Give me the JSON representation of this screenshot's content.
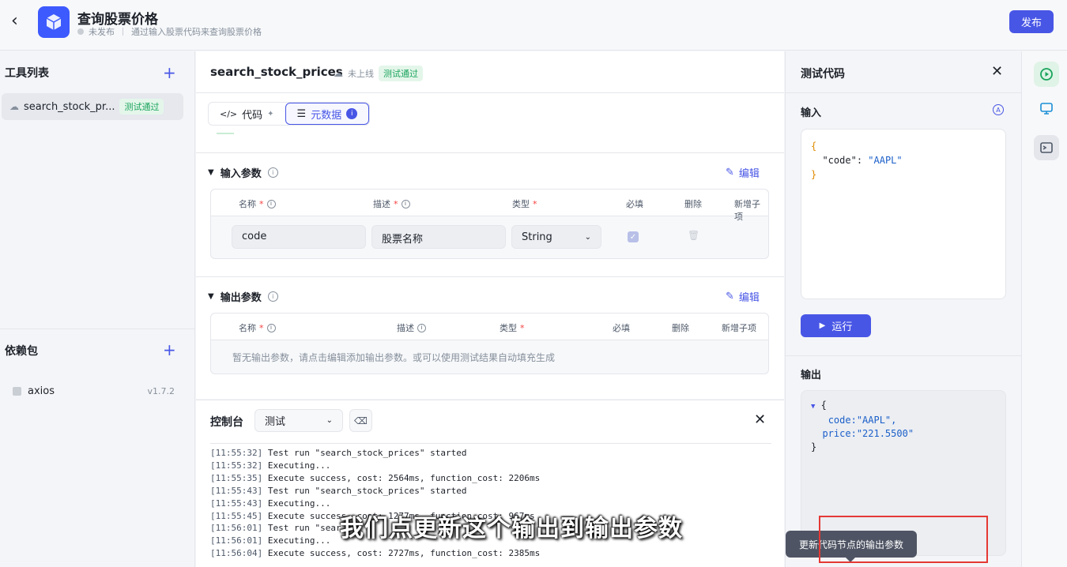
{
  "header": {
    "title": "查询股票价格",
    "status": "未发布",
    "description": "通过输入股票代码来查询股票价格",
    "publish_label": "发布"
  },
  "sidebar": {
    "tools_title": "工具列表",
    "tools": [
      {
        "name": "search_stock_pr...",
        "badge": "测试通过"
      }
    ],
    "deps_title": "依赖包",
    "deps": [
      {
        "name": "axios",
        "version": "v1.7.2"
      }
    ]
  },
  "main": {
    "tool_name": "search_stock_prices",
    "online_status": "未上线",
    "test_badge": "测试通过",
    "tabs": [
      {
        "label": "代码"
      },
      {
        "label": "元数据"
      }
    ],
    "input_params": {
      "title": "输入参数",
      "edit_label": "编辑",
      "columns": {
        "name": "名称",
        "desc": "描述",
        "type": "类型",
        "required": "必填",
        "delete": "删除",
        "add_child": "新增子项"
      },
      "rows": [
        {
          "name": "code",
          "desc": "股票名称",
          "type": "String",
          "required": true
        }
      ]
    },
    "output_params": {
      "title": "输出参数",
      "edit_label": "编辑",
      "columns": {
        "name": "名称",
        "desc": "描述",
        "type": "类型",
        "required": "必填",
        "delete": "删除",
        "add_child": "新增子项"
      },
      "empty_text": "暂无输出参数，请点击编辑添加输出参数。或可以使用测试结果自动填充生成"
    }
  },
  "console": {
    "title": "控制台",
    "env_selected": "测试",
    "logs": [
      {
        "ts": "[11:55:32]",
        "msg": " Test run \"search_stock_prices\" started"
      },
      {
        "ts": "[11:55:32]",
        "msg": " Executing..."
      },
      {
        "ts": "[11:55:35]",
        "msg": " Execute success, cost: 2564ms, function_cost: 2206ms"
      },
      {
        "ts": "[11:55:43]",
        "msg": " Test run \"search_stock_prices\" started"
      },
      {
        "ts": "[11:55:43]",
        "msg": " Executing..."
      },
      {
        "ts": "[11:55:45]",
        "msg": " Execute success, cost: 1277ms, function_cost: 967ms"
      },
      {
        "ts": "[11:56:01]",
        "msg": " Test run \"sear"
      },
      {
        "ts": "[11:56:01]",
        "msg": " Executing..."
      },
      {
        "ts": "[11:56:04]",
        "msg": " Execute success, cost: 2727ms, function_cost: 2385ms"
      }
    ]
  },
  "test_panel": {
    "title": "测试代码",
    "input_label": "输入",
    "input_key": "\"code\"",
    "input_value": "\"AAPL\"",
    "run_label": "运行",
    "output_label": "输出",
    "output": {
      "code_key": "code:",
      "code_value": "\"AAPL\",",
      "price_key": "price:",
      "price_value": "\"221.5500\""
    }
  },
  "tooltip": "更新代码节点的输出参数",
  "caption": "我们点更新这个输出到输出参数",
  "colors": {
    "accent": "#4856e6",
    "success": "#1aa45c",
    "required": "#f53f3f"
  }
}
